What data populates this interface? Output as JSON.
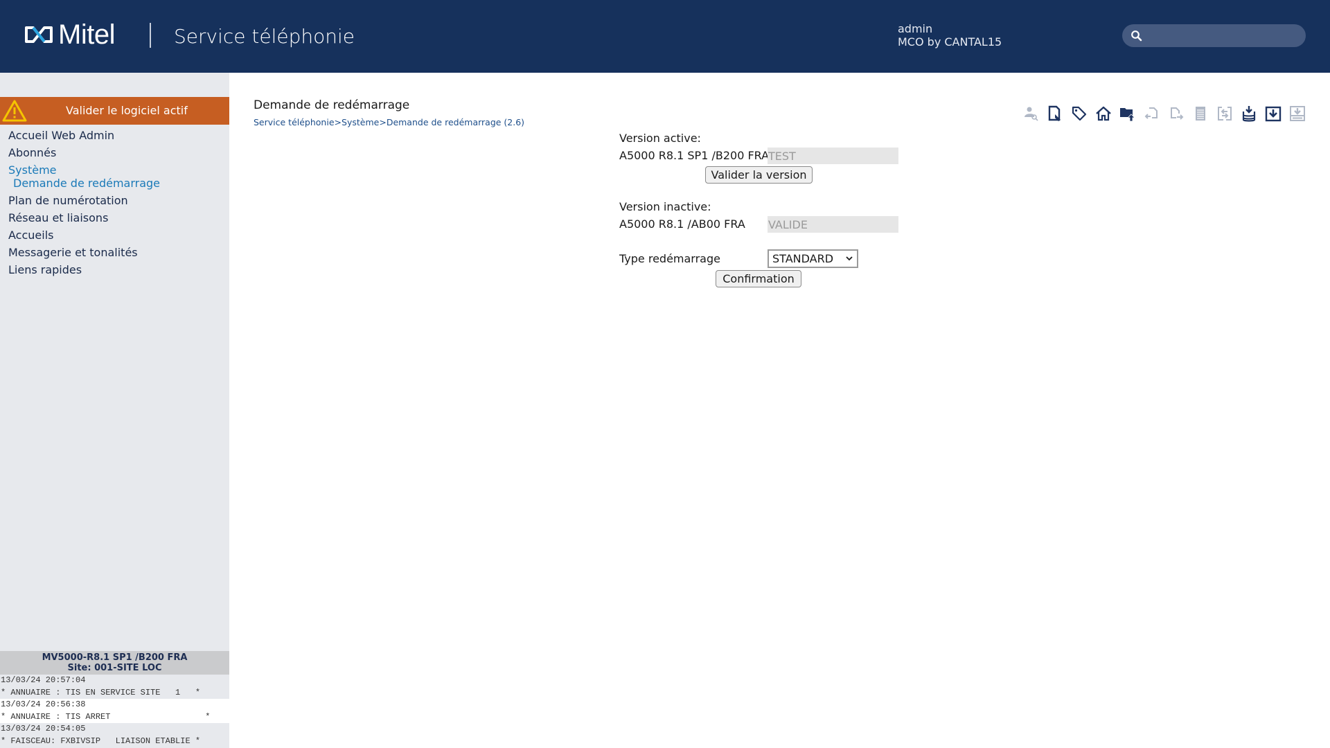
{
  "header": {
    "brand": "Mitel",
    "app_title": "Service téléphonie",
    "user_name": "admin",
    "user_org": "MCO by CANTAL15",
    "search": {
      "placeholder": "",
      "value": "",
      "icon": "search-icon"
    },
    "colors": {
      "background": "#16315c",
      "search_bg": "#455a80",
      "logo_accent": "#2aa4e0"
    }
  },
  "sidebar": {
    "warning_banner": {
      "label": "Valider le logiciel actif",
      "icon": "warning-icon",
      "color": "#c65e22"
    },
    "items": [
      {
        "label": "Accueil Web Admin",
        "active": false
      },
      {
        "label": "Abonnés",
        "active": false
      },
      {
        "label": "Système",
        "active": true
      },
      {
        "label": "Plan de numérotation",
        "active": false
      },
      {
        "label": "Réseau et liaisons",
        "active": false
      },
      {
        "label": "Accueils",
        "active": false
      },
      {
        "label": "Messagerie et tonalités",
        "active": false
      },
      {
        "label": "Liens rapides",
        "active": false
      }
    ],
    "sub_item": {
      "label": "Demande de redémarrage",
      "parent": "Système"
    },
    "status": {
      "version": "MV5000-R8.1 SP1 /B200 FRA",
      "site": "Site: 001-SITE LOC"
    },
    "log": [
      {
        "time": "13/03/24 20:57:04",
        "message": "* ANNUAIRE : TIS EN SERVICE SITE   1   *"
      },
      {
        "time": "13/03/24 20:56:38",
        "message": "* ANNUAIRE : TIS ARRET                   *"
      },
      {
        "time": "13/03/24 20:54:05",
        "message": "* FAISCEAU: FXBIVSIP   LIAISON ETABLIE *"
      }
    ]
  },
  "main": {
    "title": "Demande de redémarrage",
    "breadcrumb": [
      "Service téléphonie",
      "Système",
      "Demande de redémarrage (2.6)"
    ],
    "breadcrumb_separator": ">",
    "toolbar": [
      {
        "icon": "user-search-icon",
        "enabled": false
      },
      {
        "icon": "document-edit-icon",
        "enabled": true
      },
      {
        "icon": "tag-icon",
        "enabled": true
      },
      {
        "icon": "home-icon",
        "enabled": true
      },
      {
        "icon": "folder-upload-icon",
        "enabled": true
      },
      {
        "icon": "document-import-icon",
        "enabled": false
      },
      {
        "icon": "document-export-icon",
        "enabled": false
      },
      {
        "icon": "list-icon",
        "enabled": false
      },
      {
        "icon": "swap-icon",
        "enabled": false
      },
      {
        "icon": "database-download-icon",
        "enabled": true
      },
      {
        "icon": "download-box-icon",
        "enabled": true
      },
      {
        "icon": "download-tray-icon",
        "enabled": false
      }
    ],
    "form": {
      "active_label": "Version active:",
      "active_version": "A5000 R8.1 SP1 /B200 FRA",
      "active_state": "TEST",
      "validate_button": "Valider la version",
      "inactive_label": "Version inactive:",
      "inactive_version": "A5000 R8.1  /AB00 FRA",
      "inactive_state": "VALIDE",
      "restart_type_label": "Type redémarrage",
      "restart_type_value": "STANDARD",
      "confirm_button": "Confirmation"
    }
  }
}
